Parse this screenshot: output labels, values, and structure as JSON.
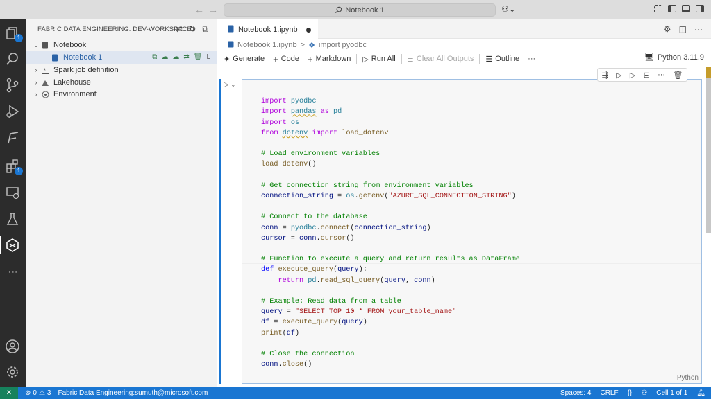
{
  "titlebar": {
    "command_center": "Notebook 1",
    "copilot_icon": "copilot-icon"
  },
  "activity_bar": {
    "items": [
      {
        "name": "explorer-icon",
        "badge": "1"
      },
      {
        "name": "search-icon"
      },
      {
        "name": "source-control-icon"
      },
      {
        "name": "run-debug-icon"
      },
      {
        "name": "pipeline-icon"
      },
      {
        "name": "extensions-icon",
        "badge": "1"
      },
      {
        "name": "remote-explorer-icon"
      },
      {
        "name": "testing-icon"
      },
      {
        "name": "fabric-icon"
      },
      {
        "name": "more-icon"
      },
      {
        "name": "accounts-icon"
      },
      {
        "name": "settings-icon"
      }
    ]
  },
  "sidebar": {
    "header": "FABRIC DATA ENGINEERING: DEV-WORKSPACE1",
    "tree": [
      {
        "label": "Notebook",
        "expanded": true
      },
      {
        "label": "Notebook 1",
        "selected": true
      },
      {
        "label": "Spark job definition",
        "expanded": false
      },
      {
        "label": "Lakehouse",
        "expanded": false
      },
      {
        "label": "Environment",
        "expanded": false
      }
    ],
    "row_action_letter": "L"
  },
  "tabs": [
    {
      "label": "Notebook 1.ipynb",
      "dirty": true
    }
  ],
  "breadcrumb": {
    "file": "Notebook 1.ipynb",
    "separator": ">",
    "cell": "import pyodbc"
  },
  "toolbar": {
    "generate": "Generate",
    "code": "Code",
    "markdown": "Markdown",
    "run_all": "Run All",
    "clear_outputs": "Clear All Outputs",
    "outline": "Outline",
    "more": "···",
    "kernel": "Python 3.11.9"
  },
  "cell": {
    "language": "Python",
    "code_lines": [
      "import pyodbc",
      "import pandas as pd",
      "import os",
      "from dotenv import load_dotenv",
      "",
      "# Load environment variables",
      "load_dotenv()",
      "",
      "# Get connection string from environment variables",
      "connection_string = os.getenv(\"AZURE_SQL_CONNECTION_STRING\")",
      "",
      "# Connect to the database",
      "conn = pyodbc.connect(connection_string)",
      "cursor = conn.cursor()",
      "",
      "# Function to execute a query and return results as DataFrame",
      "def execute_query(query):",
      "    return pd.read_sql_query(query, conn)",
      "",
      "# Example: Read data from a table",
      "query = \"SELECT TOP 10 * FROM your_table_name\"",
      "df = execute_query(query)",
      "print(df)",
      "",
      "# Close the connection",
      "conn.close()"
    ]
  },
  "statusbar": {
    "problems_errors": "0",
    "problems_warnings": "3",
    "account": "Fabric Data Engineering:sumuth@microsoft.com",
    "spaces": "Spaces: 4",
    "eol": "CRLF",
    "braces": "{}",
    "cell_pos": "Cell 1 of 1"
  },
  "colors": {
    "accent": "#1a76d2",
    "activity_bg": "#2c2c2c",
    "sidebar_bg": "#f3f3f3",
    "remote_bg": "#16825d"
  }
}
